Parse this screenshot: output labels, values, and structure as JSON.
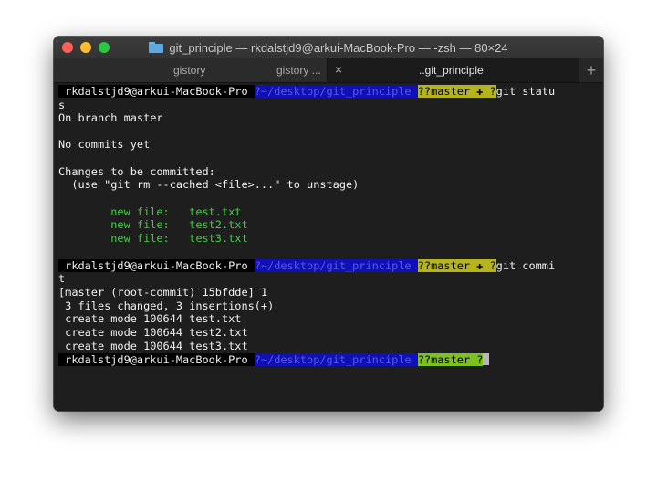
{
  "window": {
    "title": "git_principle — rkdalstjd9@arkui-MacBook-Pro — -zsh — 80×24",
    "folder_icon": "folder-icon"
  },
  "tabs": [
    {
      "label": "gistory",
      "secondary": "gistory ..."
    },
    {
      "label": "..git_principle",
      "close": "×"
    },
    {
      "label": "+"
    }
  ],
  "terminal": {
    "prompt1": {
      "user": " rkdalstjd9@arkui-MacBook-Pro ",
      "path": "?~/desktop/git_principle ",
      "branch": "??master ✚ ",
      "end": "?",
      "cmd": "git statu",
      "wrap": "s"
    },
    "status_lines": [
      "On branch master",
      "",
      "No commits yet",
      "",
      "Changes to be committed:",
      "  (use \"git rm --cached <file>...\" to unstage)"
    ],
    "new_files": [
      "        new file:   test.txt",
      "        new file:   test2.txt",
      "        new file:   test3.txt"
    ],
    "prompt2": {
      "user": " rkdalstjd9@arkui-MacBook-Pro ",
      "path": "?~/desktop/git_principle ",
      "branch": "??master ✚ ",
      "end": "?",
      "cmd": "git commi",
      "wrap": "t"
    },
    "commit_lines": [
      "[master (root-commit) 15bfdde] 1",
      " 3 files changed, 3 insertions(+)",
      " create mode 100644 test.txt",
      " create mode 100644 test2.txt",
      " create mode 100644 test3.txt"
    ],
    "prompt3": {
      "user": " rkdalstjd9@arkui-MacBook-Pro ",
      "path": "?~/desktop/git_principle ",
      "branch": "??master ",
      "end": "?"
    }
  },
  "colors": {
    "path_bg": "#1010b8",
    "branch_dirty_bg": "#b5b41f",
    "branch_clean_bg": "#7cc11f",
    "new_file": "#3fcf3f"
  }
}
